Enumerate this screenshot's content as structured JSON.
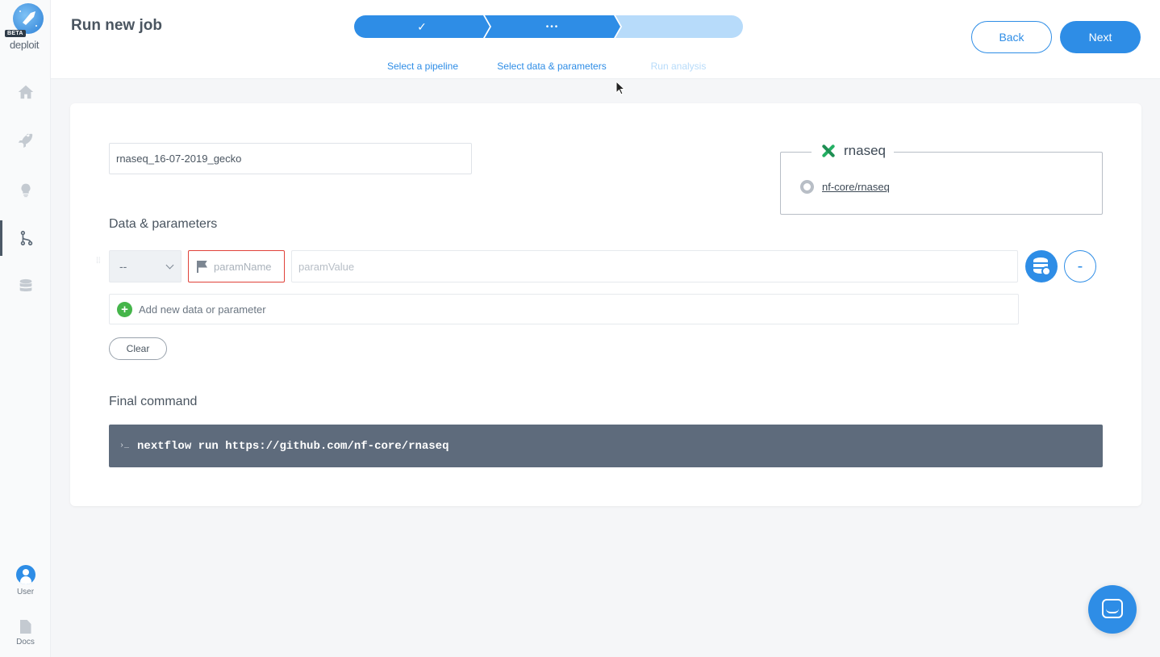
{
  "brand": {
    "badge": "BETA",
    "name": "deploit"
  },
  "sidebar": {
    "items": [
      {
        "icon": "home-icon"
      },
      {
        "icon": "rocket-icon"
      },
      {
        "icon": "lightbulb-icon"
      },
      {
        "icon": "pipeline-branch-icon",
        "active": true
      },
      {
        "icon": "database-icon"
      }
    ],
    "user_label": "User",
    "docs_label": "Docs"
  },
  "header": {
    "title": "Run new job",
    "steps": [
      {
        "label": "Select a pipeline",
        "state": "done",
        "marker": "✓"
      },
      {
        "label": "Select data & parameters",
        "state": "current",
        "marker": "•••"
      },
      {
        "label": "Run analysis",
        "state": "pending",
        "marker": ""
      }
    ],
    "back_label": "Back",
    "next_label": "Next"
  },
  "form": {
    "job_name": "rnaseq_16-07-2019_gecko",
    "pipeline": {
      "name": "rnaseq",
      "repo": "nf-core/rnaseq"
    },
    "data_section_title": "Data & parameters",
    "param_row": {
      "type_value": "--",
      "name_placeholder": "paramName",
      "value_placeholder": "paramValue",
      "remove_label": "-"
    },
    "add_label": "Add new data or parameter",
    "add_symbol": "+",
    "clear_label": "Clear",
    "command_section_title": "Final command",
    "command_prompt": "›_",
    "command": "nextflow run https://github.com/nf-core/rnaseq"
  },
  "colors": {
    "accent": "#2e8de6",
    "error_border": "#e0423a",
    "command_bg": "#5e6b7c",
    "add_green": "#45b54a"
  }
}
